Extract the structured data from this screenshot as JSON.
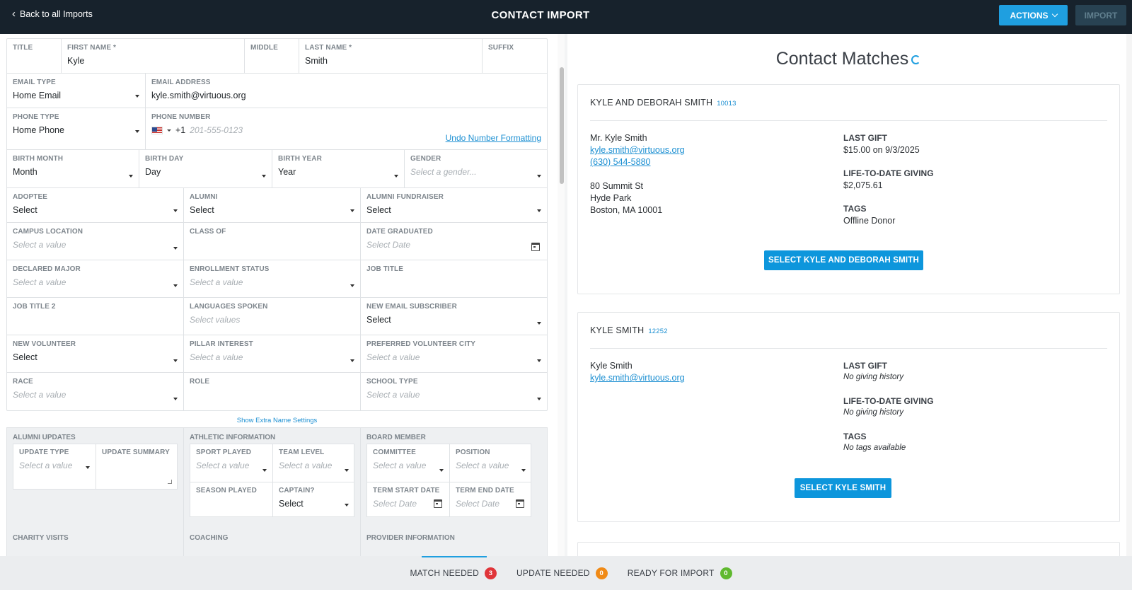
{
  "header": {
    "back_label": "Back to all Imports",
    "title": "CONTACT IMPORT",
    "actions_label": "ACTIONS",
    "import_label": "IMPORT"
  },
  "form": {
    "title_label": "TITLE",
    "first_name_label": "FIRST NAME *",
    "first_name_value": "Kyle",
    "middle_label": "MIDDLE",
    "last_name_label": "LAST NAME *",
    "last_name_value": "Smith",
    "suffix_label": "SUFFIX",
    "email_type_label": "EMAIL TYPE",
    "email_type_value": "Home Email",
    "email_address_label": "EMAIL ADDRESS",
    "email_address_value": "kyle.smith@virtuous.org",
    "phone_type_label": "PHONE TYPE",
    "phone_type_value": "Home Phone",
    "phone_number_label": "PHONE NUMBER",
    "phone_code": "+1",
    "phone_placeholder": "201-555-0123",
    "undo_label": "Undo Number Formatting",
    "birth_month_label": "BIRTH MONTH",
    "birth_month_value": "Month",
    "birth_day_label": "BIRTH DAY",
    "birth_day_value": "Day",
    "birth_year_label": "BIRTH YEAR",
    "birth_year_value": "Year",
    "gender_label": "GENDER",
    "gender_placeholder": "Select a gender...",
    "grid": [
      [
        {
          "label": "ADOPTEE",
          "value": "Select",
          "kind": "select"
        },
        {
          "label": "ALUMNI",
          "value": "Select",
          "kind": "select"
        },
        {
          "label": "ALUMNI FUNDRAISER",
          "value": "Select",
          "kind": "select"
        }
      ],
      [
        {
          "label": "CAMPUS LOCATION",
          "placeholder": "Select a value",
          "kind": "select"
        },
        {
          "label": "CLASS OF",
          "kind": "text"
        },
        {
          "label": "DATE GRADUATED",
          "placeholder": "Select Date",
          "kind": "date"
        }
      ],
      [
        {
          "label": "DECLARED MAJOR",
          "placeholder": "Select a value",
          "kind": "select"
        },
        {
          "label": "ENROLLMENT STATUS",
          "placeholder": "Select a value",
          "kind": "select"
        },
        {
          "label": "JOB TITLE",
          "kind": "text"
        }
      ],
      [
        {
          "label": "JOB TITLE 2",
          "kind": "text"
        },
        {
          "label": "LANGUAGES SPOKEN",
          "placeholder": "Select values",
          "kind": "multi"
        },
        {
          "label": "NEW EMAIL SUBSCRIBER",
          "value": "Select",
          "kind": "select"
        }
      ],
      [
        {
          "label": "NEW VOLUNTEER",
          "value": "Select",
          "kind": "select"
        },
        {
          "label": "PILLAR INTEREST",
          "placeholder": "Select a value",
          "kind": "select"
        },
        {
          "label": "PREFERRED VOLUNTEER CITY",
          "placeholder": "Select a value",
          "kind": "select"
        }
      ],
      [
        {
          "label": "RACE",
          "placeholder": "Select a value",
          "kind": "select"
        },
        {
          "label": "ROLE",
          "kind": "text"
        },
        {
          "label": "SCHOOL TYPE",
          "placeholder": "Select a value",
          "kind": "select"
        }
      ]
    ],
    "extra_name_link": "Show Extra Name Settings"
  },
  "groups": {
    "alumni_updates": {
      "title": "ALUMNI UPDATES",
      "update_type_label": "UPDATE TYPE",
      "update_type_placeholder": "Select a value",
      "update_summary_label": "UPDATE SUMMARY"
    },
    "athletic": {
      "title": "ATHLETIC INFORMATION",
      "sport_label": "SPORT PLAYED",
      "sport_placeholder": "Select a value",
      "team_label": "TEAM LEVEL",
      "team_placeholder": "Select a value",
      "season_label": "SEASON PLAYED",
      "captain_label": "CAPTAIN?",
      "captain_value": "Select"
    },
    "board": {
      "title": "BOARD MEMBER",
      "committee_label": "COMMITTEE",
      "committee_placeholder": "Select a value",
      "position_label": "POSITION",
      "position_placeholder": "Select a value",
      "term_start_label": "TERM START DATE",
      "term_start_placeholder": "Select Date",
      "term_end_label": "TERM END DATE",
      "term_end_placeholder": "Select Date"
    },
    "charity_title": "CHARITY VISITS",
    "coaching_title": "COACHING",
    "provider_title": "PROVIDER INFORMATION"
  },
  "matches": {
    "title": "Contact Matches",
    "cards": [
      {
        "name": "KYLE AND DEBORAH SMITH",
        "id": "10013",
        "full_name": "Mr. Kyle Smith",
        "email": "kyle.smith@virtuous.org",
        "phone": "(630) 544-5880",
        "address1": "80 Summit St",
        "address2": "Hyde Park",
        "address3": "Boston, MA 10001",
        "last_gift_label": "LAST GIFT",
        "last_gift_value": "$15.00 on 9/3/2025",
        "ltd_label": "LIFE-TO-DATE GIVING",
        "ltd_value": "$2,075.61",
        "tags_label": "TAGS",
        "tags_value": "Offline Donor",
        "button_label": "SELECT KYLE AND DEBORAH SMITH"
      },
      {
        "name": "KYLE SMITH",
        "id": "12252",
        "full_name": "Kyle Smith",
        "email": "kyle.smith@virtuous.org",
        "last_gift_label": "LAST GIFT",
        "last_gift_value": "No giving history",
        "ltd_label": "LIFE-TO-DATE GIVING",
        "ltd_value": "No giving history",
        "tags_label": "TAGS",
        "tags_value": "No tags available",
        "button_label": "SELECT KYLE SMITH"
      }
    ]
  },
  "status_bar": {
    "match_label": "MATCH NEEDED",
    "match_count": "3",
    "update_label": "UPDATE NEEDED",
    "update_count": "0",
    "ready_label": "READY FOR IMPORT",
    "ready_count": "0",
    "colors": {
      "match": "#e0353a",
      "update": "#f08a16",
      "ready": "#5fb92f"
    }
  }
}
